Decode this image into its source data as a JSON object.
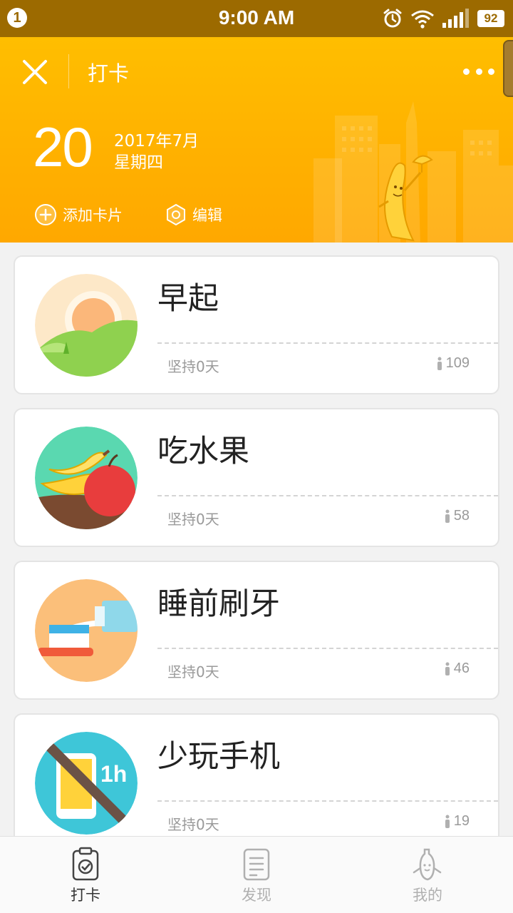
{
  "status_bar": {
    "notification_count": "1",
    "time": "9:00 AM",
    "battery": "92",
    "icons": [
      "alarm-icon",
      "wifi-icon",
      "signal-icon",
      "battery-icon"
    ]
  },
  "header": {
    "title": "打卡",
    "day": "20",
    "year_month": "2017年7月",
    "weekday": "星期四",
    "add_card_label": "添加卡片",
    "edit_label": "编辑",
    "colors": {
      "primary": "#ffb300",
      "status_bar": "#9c6a00"
    }
  },
  "cards": [
    {
      "title": "早起",
      "streak": "坚持0天",
      "count": "109",
      "icon": "sunrise-icon"
    },
    {
      "title": "吃水果",
      "streak": "坚持0天",
      "count": "58",
      "icon": "fruit-icon"
    },
    {
      "title": "睡前刷牙",
      "streak": "坚持0天",
      "count": "46",
      "icon": "toothbrush-icon"
    },
    {
      "title": "少玩手机",
      "streak": "坚持0天",
      "count": "19",
      "icon": "no-phone-icon"
    }
  ],
  "phone_icon_text": "1h",
  "tabs": [
    {
      "label": "打卡",
      "icon": "clipboard-check-icon",
      "active": true
    },
    {
      "label": "发现",
      "icon": "document-list-icon",
      "active": false
    },
    {
      "label": "我的",
      "icon": "banana-mascot-icon",
      "active": false
    }
  ]
}
